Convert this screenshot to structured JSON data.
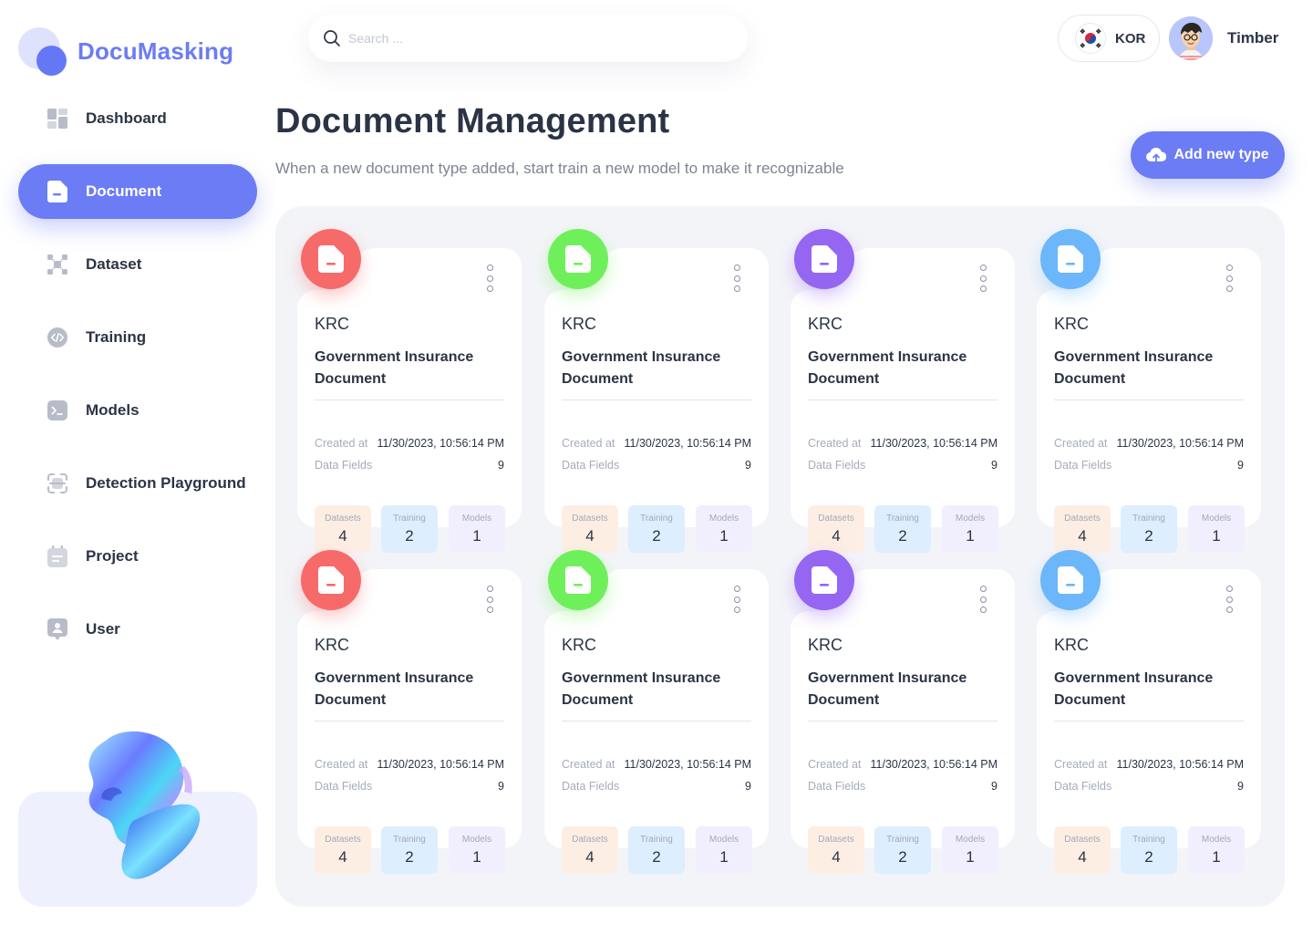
{
  "app": {
    "name": "DocuMasking"
  },
  "sidebar": {
    "items": [
      {
        "label": "Dashboard",
        "icon": "dashboard-icon",
        "active": false
      },
      {
        "label": "Document",
        "icon": "document-icon",
        "active": true
      },
      {
        "label": "Dataset",
        "icon": "dataset-icon",
        "active": false
      },
      {
        "label": "Training",
        "icon": "code-icon",
        "active": false
      },
      {
        "label": "Models",
        "icon": "terminal-icon",
        "active": false
      },
      {
        "label": "Detection Playground",
        "icon": "scan-icon",
        "active": false
      },
      {
        "label": "Project",
        "icon": "calendar-icon",
        "active": false
      },
      {
        "label": "User",
        "icon": "user-badge-icon",
        "active": false
      }
    ]
  },
  "search": {
    "placeholder": "Search ..."
  },
  "header": {
    "language": "KOR",
    "user_name": "Timber",
    "title": "Document Management",
    "subtitle": "When a new document type added, start train a new model to make it recognizable",
    "add_button": "Add new type"
  },
  "cards": [
    {
      "color": "red",
      "org": "KRC",
      "name": "Government Insurance Document",
      "created_label": "Created at",
      "created_value": "11/30/2023, 10:56:14 PM",
      "fields_label": "Data Fields",
      "fields_value": "9",
      "datasets_label": "Datasets",
      "datasets": "4",
      "training_label": "Training",
      "training": "2",
      "models_label": "Models",
      "models": "1"
    },
    {
      "color": "green",
      "org": "KRC",
      "name": "Government Insurance Document",
      "created_label": "Created at",
      "created_value": "11/30/2023, 10:56:14 PM",
      "fields_label": "Data Fields",
      "fields_value": "9",
      "datasets_label": "Datasets",
      "datasets": "4",
      "training_label": "Training",
      "training": "2",
      "models_label": "Models",
      "models": "1"
    },
    {
      "color": "purple",
      "org": "KRC",
      "name": "Government Insurance Document",
      "created_label": "Created at",
      "created_value": "11/30/2023, 10:56:14 PM",
      "fields_label": "Data Fields",
      "fields_value": "9",
      "datasets_label": "Datasets",
      "datasets": "4",
      "training_label": "Training",
      "training": "2",
      "models_label": "Models",
      "models": "1"
    },
    {
      "color": "blue",
      "org": "KRC",
      "name": "Government Insurance Document",
      "created_label": "Created at",
      "created_value": "11/30/2023, 10:56:14 PM",
      "fields_label": "Data Fields",
      "fields_value": "9",
      "datasets_label": "Datasets",
      "datasets": "4",
      "training_label": "Training",
      "training": "2",
      "models_label": "Models",
      "models": "1"
    },
    {
      "color": "red",
      "org": "KRC",
      "name": "Government Insurance Document",
      "created_label": "Created at",
      "created_value": "11/30/2023, 10:56:14 PM",
      "fields_label": "Data Fields",
      "fields_value": "9",
      "datasets_label": "Datasets",
      "datasets": "4",
      "training_label": "Training",
      "training": "2",
      "models_label": "Models",
      "models": "1"
    },
    {
      "color": "green",
      "org": "KRC",
      "name": "Government Insurance Document",
      "created_label": "Created at",
      "created_value": "11/30/2023, 10:56:14 PM",
      "fields_label": "Data Fields",
      "fields_value": "9",
      "datasets_label": "Datasets",
      "datasets": "4",
      "training_label": "Training",
      "training": "2",
      "models_label": "Models",
      "models": "1"
    },
    {
      "color": "purple",
      "org": "KRC",
      "name": "Government Insurance Document",
      "created_label": "Created at",
      "created_value": "11/30/2023, 10:56:14 PM",
      "fields_label": "Data Fields",
      "fields_value": "9",
      "datasets_label": "Datasets",
      "datasets": "4",
      "training_label": "Training",
      "training": "2",
      "models_label": "Models",
      "models": "1"
    },
    {
      "color": "blue",
      "org": "KRC",
      "name": "Government Insurance Document",
      "created_label": "Created at",
      "created_value": "11/30/2023, 10:56:14 PM",
      "fields_label": "Data Fields",
      "fields_value": "9",
      "datasets_label": "Datasets",
      "datasets": "4",
      "training_label": "Training",
      "training": "2",
      "models_label": "Models",
      "models": "1"
    }
  ],
  "colors": {
    "accent": "#6b7cf5",
    "red": "#f76a6a",
    "green": "#6ff05a",
    "purple": "#9466f2",
    "blue": "#6cb6fb"
  }
}
